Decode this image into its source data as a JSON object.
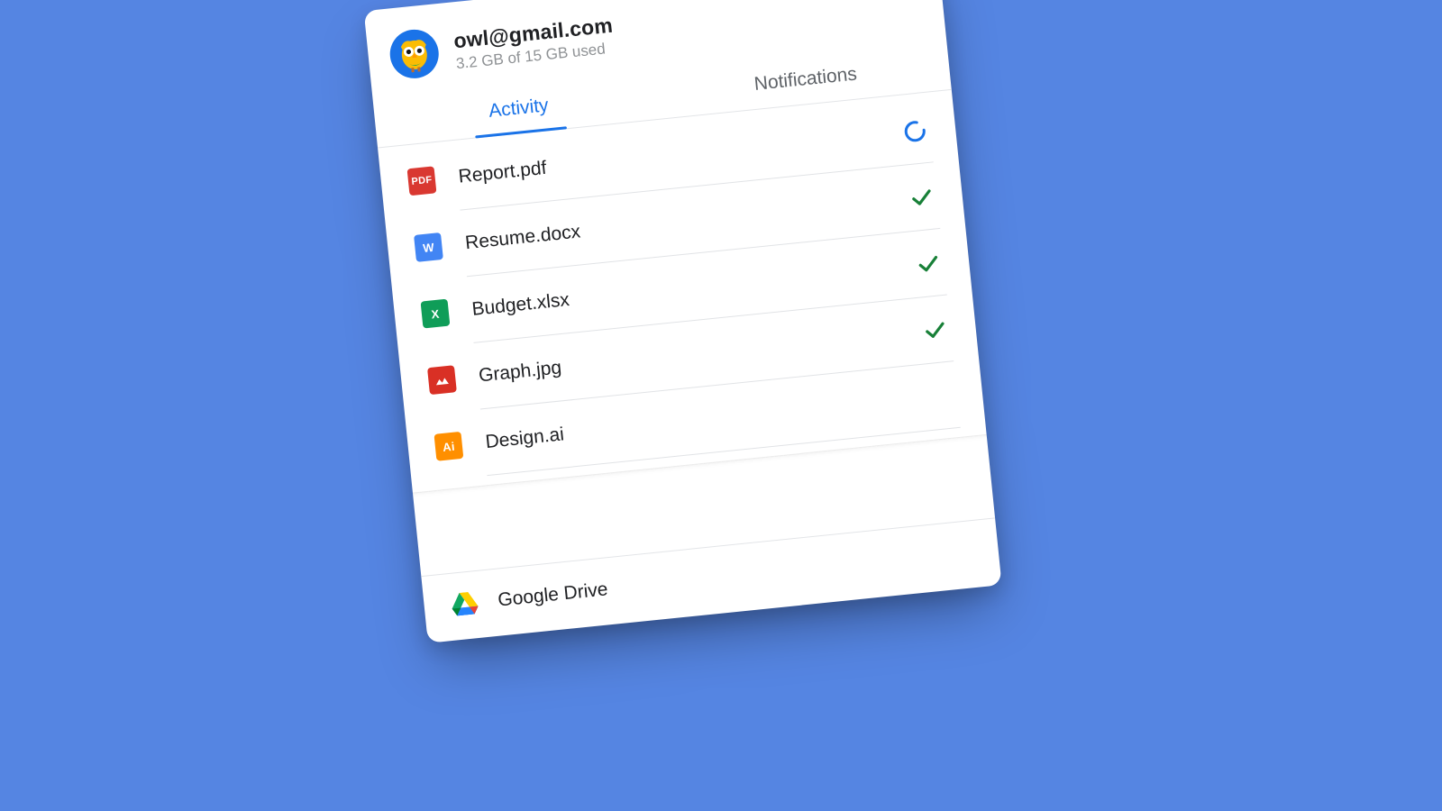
{
  "account": {
    "email": "owl@gmail.com",
    "storage": "3.2 GB of 15 GB used",
    "avatar_name": "owl-avatar"
  },
  "tabs": {
    "activity": "Activity",
    "notifications": "Notifications",
    "active": "activity"
  },
  "files": [
    {
      "name": "Report.pdf",
      "type": "pdf",
      "icon_text": "PDF",
      "status": "uploading"
    },
    {
      "name": "Resume.docx",
      "type": "docx",
      "icon_text": "W",
      "status": "done"
    },
    {
      "name": "Budget.xlsx",
      "type": "xlsx",
      "icon_text": "X",
      "status": "done"
    },
    {
      "name": "Graph.jpg",
      "type": "img",
      "icon_text": "",
      "status": "done"
    },
    {
      "name": "Design.ai",
      "type": "ai",
      "icon_text": "Ai",
      "status": "done"
    }
  ],
  "footer": {
    "label": "Google Drive"
  },
  "icons": {
    "settings": "gear-icon",
    "spinner": "loading-spinner-icon",
    "check": "checkmark-icon",
    "drive": "google-drive-logo-icon"
  }
}
